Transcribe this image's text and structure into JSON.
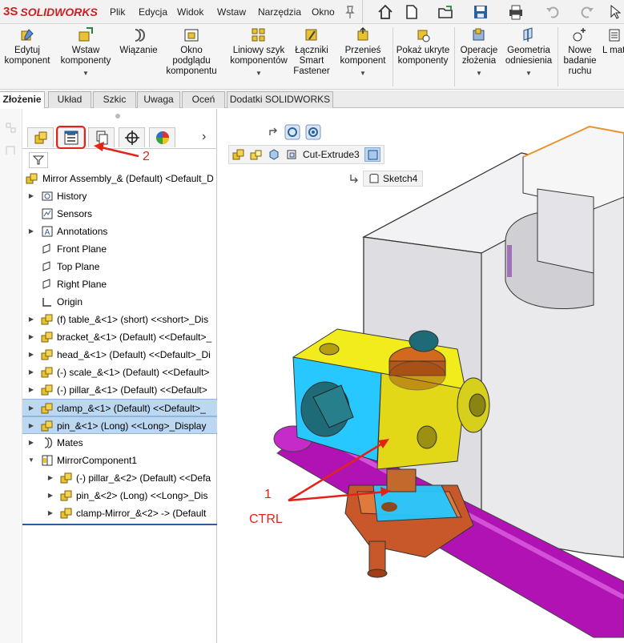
{
  "app": {
    "brand": "SOLIDWORKS",
    "brand_prefix": "3S"
  },
  "menu": [
    "Plik",
    "Edycja",
    "Widok",
    "Wstaw",
    "Narzędzia",
    "Okno"
  ],
  "ribbon": [
    {
      "label": "Edytuj komponent",
      "icon": "edit-component-icon"
    },
    {
      "label": "Wstaw komponenty",
      "icon": "insert-components-icon"
    },
    {
      "label": "Wiązanie",
      "icon": "mate-icon"
    },
    {
      "label": "Okno podglądu komponentu",
      "icon": "component-preview-icon"
    },
    {
      "label": "Liniowy szyk komponentów",
      "icon": "linear-pattern-icon"
    },
    {
      "label": "Łączniki Smart Fastener",
      "icon": "smart-fasteners-icon"
    },
    {
      "label": "Przenieś komponent",
      "icon": "move-component-icon"
    },
    {
      "label": "Pokaż ukryte komponenty",
      "icon": "show-hidden-icon"
    },
    {
      "label": "Operacje złożenia",
      "icon": "assembly-features-icon"
    },
    {
      "label": "Geometria odniesienia",
      "icon": "reference-geometry-icon"
    },
    {
      "label": "Nowe badanie ruchu",
      "icon": "motion-study-icon"
    },
    {
      "label": "L mate",
      "icon": "bill-of-materials-icon"
    }
  ],
  "tabs": [
    "Złożenie",
    "Układ",
    "Szkic",
    "Uwaga",
    "Oceń",
    "Dodatki SOLIDWORKS"
  ],
  "tree": {
    "root": "Mirror Assembly_& (Default) <Default_D",
    "items": [
      {
        "label": "History",
        "icon": "history-icon",
        "expander": "▶"
      },
      {
        "label": "Sensors",
        "icon": "sensor-icon",
        "expander": ""
      },
      {
        "label": "Annotations",
        "icon": "annotations-icon",
        "expander": "▶"
      },
      {
        "label": "Front Plane",
        "icon": "plane-icon",
        "expander": ""
      },
      {
        "label": "Top Plane",
        "icon": "plane-icon",
        "expander": ""
      },
      {
        "label": "Right Plane",
        "icon": "plane-icon",
        "expander": ""
      },
      {
        "label": "Origin",
        "icon": "origin-icon",
        "expander": ""
      },
      {
        "label": "(f) table_&<1> (short) <<short>_Dis",
        "icon": "part-icon",
        "expander": "▶"
      },
      {
        "label": "bracket_&<1> (Default) <<Default>_",
        "icon": "part-icon",
        "expander": "▶"
      },
      {
        "label": "head_&<1> (Default) <<Default>_Di",
        "icon": "part-icon",
        "expander": "▶"
      },
      {
        "label": "(-) scale_&<1> (Default) <<Default>",
        "icon": "part-icon",
        "expander": "▶"
      },
      {
        "label": "(-) pillar_&<1> (Default) <<Default>",
        "icon": "part-icon",
        "expander": "▶"
      },
      {
        "label": "clamp_&<1> (Default) <<Default>_",
        "icon": "part-icon",
        "expander": "▶",
        "selected": true
      },
      {
        "label": "pin_&<1> (Long) <<Long>_Display",
        "icon": "part-icon",
        "expander": "▶",
        "selected": true
      },
      {
        "label": "Mates",
        "icon": "mates-icon",
        "expander": "▶"
      },
      {
        "label": "MirrorComponent1",
        "icon": "mirror-component-icon",
        "expander": "▼"
      }
    ],
    "children": [
      {
        "label": "(-) pillar_&<2> (Default) <<Defa",
        "icon": "part-icon",
        "expander": "▶"
      },
      {
        "label": "pin_&<2> (Long) <<Long>_Dis",
        "icon": "part-icon",
        "expander": "▶"
      },
      {
        "label": "clamp-Mirror_&<2> -> (Default",
        "icon": "part-icon",
        "expander": "▶"
      }
    ]
  },
  "breadcrumb": {
    "feature": "Cut-Extrude3",
    "sketch": "Sketch4"
  },
  "annotations": {
    "tab_marker": "2",
    "select_marker": "1",
    "ctrl_hint": "CTRL"
  },
  "colors": {
    "brand": "#d01e22",
    "annotation": "#e42318",
    "selection": "#bcd7f0",
    "clamp": "#f2ec1c",
    "pin": "#a30ea5",
    "cap": "#d2691e"
  }
}
